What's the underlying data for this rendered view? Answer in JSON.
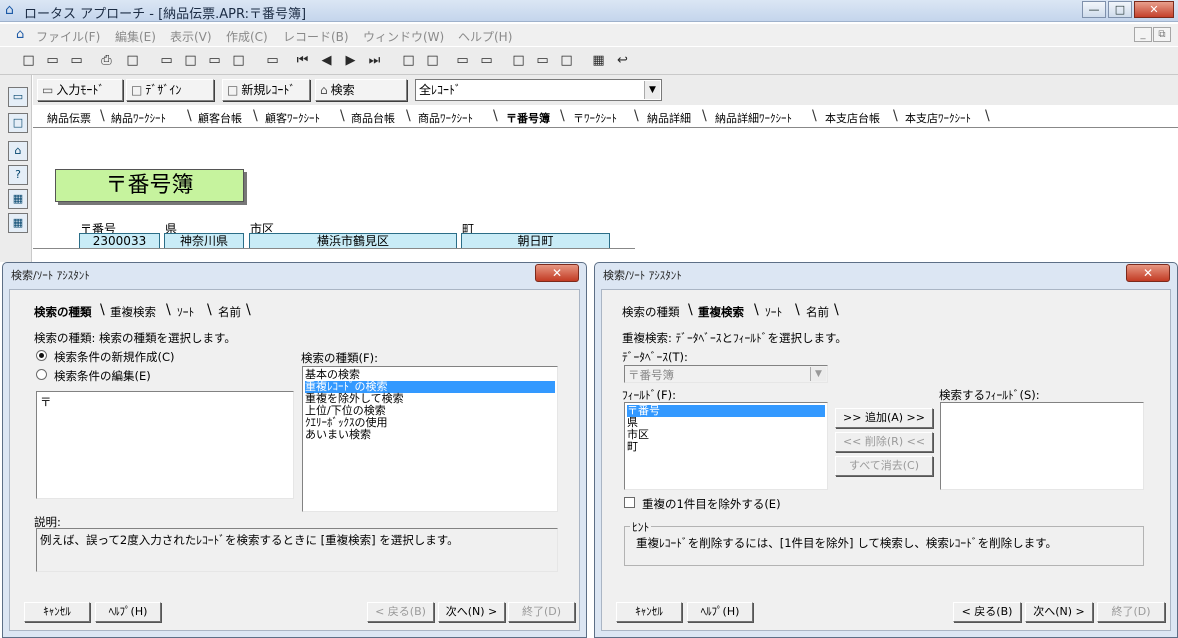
{
  "window": {
    "title": "ロータス アプローチ - [納品伝票.APR:〒番号簿]",
    "min": "—",
    "max": "□",
    "close": "✕",
    "mdi_min": "_",
    "mdi_restore": "⧉"
  },
  "menu": [
    "ファイル(F)",
    "編集(E)",
    "表示(V)",
    "作成(C)",
    "レコード(B)",
    "ウィンドウ(W)",
    "ヘルプ(H)"
  ],
  "toolbar2": {
    "input_mode": "入力ﾓｰﾄﾞ",
    "design": "ﾃﾞｻﾞｲﾝ",
    "new_record": "新規ﾚｺｰﾄﾞ",
    "search": "検索",
    "record_filter": "全ﾚｺｰﾄﾞ"
  },
  "view_tabs": [
    "納品伝票",
    "納品ﾜｰｸｼｰﾄ",
    "顧客台帳",
    "顧客ﾜｰｸｼｰﾄ",
    "商品台帳",
    "商品ﾜｰｸｼｰﾄ",
    "〒番号簿",
    "〒ﾜｰｸｼｰﾄ",
    "納品詳細",
    "納品詳細ﾜｰｸｼｰﾄ",
    "本支店台帳",
    "本支店ﾜｰｸｼｰﾄ"
  ],
  "form": {
    "title": "〒番号簿",
    "fields": [
      {
        "label": "〒番号",
        "value": "2300033"
      },
      {
        "label": "県",
        "value": "神奈川県"
      },
      {
        "label": "市区",
        "value": "横浜市鶴見区"
      },
      {
        "label": "町",
        "value": "朝日町"
      }
    ]
  },
  "dialog_left": {
    "title": "検索/ｿｰﾄ ｱｼｽﾀﾝﾄ",
    "tabs": [
      "検索の種類",
      "重複検索",
      "ｿｰﾄ",
      "名前"
    ],
    "instruction": "検索の種類: 検索の種類を選択します。",
    "radio_new": "検索条件の新規作成(C)",
    "radio_edit": "検索条件の編集(E)",
    "conditions_text": "〒",
    "types_label": "検索の種類(F):",
    "types": [
      "基本の検索",
      "重複ﾚｺｰﾄﾞの検索",
      "重複を除外して検索",
      "上位/下位の検索",
      "ｸｴﾘｰﾎﾞｯｸｽの使用",
      "あいまい検索"
    ],
    "desc_label": "説明:",
    "desc_text": "例えば、誤って2度入力されたﾚｺｰﾄﾞを検索するときに [重複検索] を選択します。",
    "cancel": "ｷｬﾝｾﾙ",
    "help": "ﾍﾙﾌﾟ(H)",
    "back": "< 戻る(B)",
    "next": "次へ(N) >",
    "finish": "終了(D)"
  },
  "dialog_right": {
    "title": "検索/ｿｰﾄ ｱｼｽﾀﾝﾄ",
    "tabs": [
      "検索の種類",
      "重複検索",
      "ｿｰﾄ",
      "名前"
    ],
    "instruction": "重複検索: ﾃﾞｰﾀﾍﾞｰｽとﾌｨｰﾙﾄﾞを選択します。",
    "db_label": "ﾃﾞｰﾀﾍﾞｰｽ(T):",
    "db_value": "〒番号簿",
    "fields_label": "ﾌｨｰﾙﾄﾞ(F):",
    "fields": [
      "〒番号",
      "県",
      "市区",
      "町"
    ],
    "add": ">> 追加(A) >>",
    "remove": "<< 削除(R) <<",
    "clear_all": "すべて消去(C)",
    "search_fields_label": "検索するﾌｨｰﾙﾄﾞ(S):",
    "exclude_first": "重複の1件目を除外する(E)",
    "hint_label": "ﾋﾝﾄ",
    "hint_text": "重複ﾚｺｰﾄﾞを削除するには、[1件目を除外] して検索し、検索ﾚｺｰﾄﾞを削除します。",
    "cancel": "ｷｬﾝｾﾙ",
    "help": "ﾍﾙﾌﾟ(H)",
    "back": "< 戻る(B)",
    "next": "次へ(N) >",
    "finish": "終了(D)"
  },
  "icons": {
    "app": "⌂",
    "new": "□",
    "open": "▭",
    "print": "⎙",
    "first": "⏮",
    "prev": "◀",
    "next": "▶",
    "last": "⏭",
    "undo": "↩",
    "dropdown": "▼",
    "side1": "⌂",
    "side2": "?",
    "side3": "▦"
  }
}
